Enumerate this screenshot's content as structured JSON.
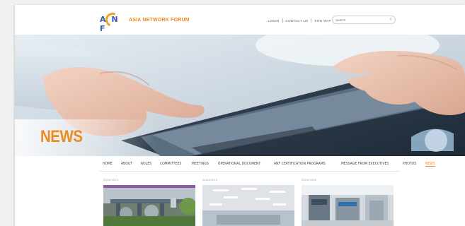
{
  "brand": {
    "logo_letters": "A N F",
    "name": "ASIA NETWORK FORUM",
    "accent_color": "#f08a1c",
    "logo_blue": "#3b5fa6"
  },
  "top_links": [
    {
      "label": "LOGIN"
    },
    {
      "label": "CONTACT US"
    },
    {
      "label": "SITE MAP"
    }
  ],
  "search": {
    "placeholder": "Search",
    "icon": "search-icon"
  },
  "hero": {
    "title": "NEWS"
  },
  "nav": {
    "items": [
      {
        "label": "HOME"
      },
      {
        "label": "ABOUT"
      },
      {
        "label": "ROLES"
      },
      {
        "label": "COMMITTEES"
      },
      {
        "label": "MEETINGS"
      },
      {
        "label": "OPERATIONAL DOCUMENT"
      },
      {
        "label": "ANF CERTIFICATION PROGRAMS"
      },
      {
        "label": "MESSAGE FROM EXECUTIVES"
      },
      {
        "label": "PHOTOS"
      },
      {
        "label": "NEWS",
        "active": true
      }
    ]
  },
  "news": [
    {
      "date": "2016/09/15"
    },
    {
      "date": "2016/09/15"
    },
    {
      "date": "2016/09/06"
    }
  ]
}
